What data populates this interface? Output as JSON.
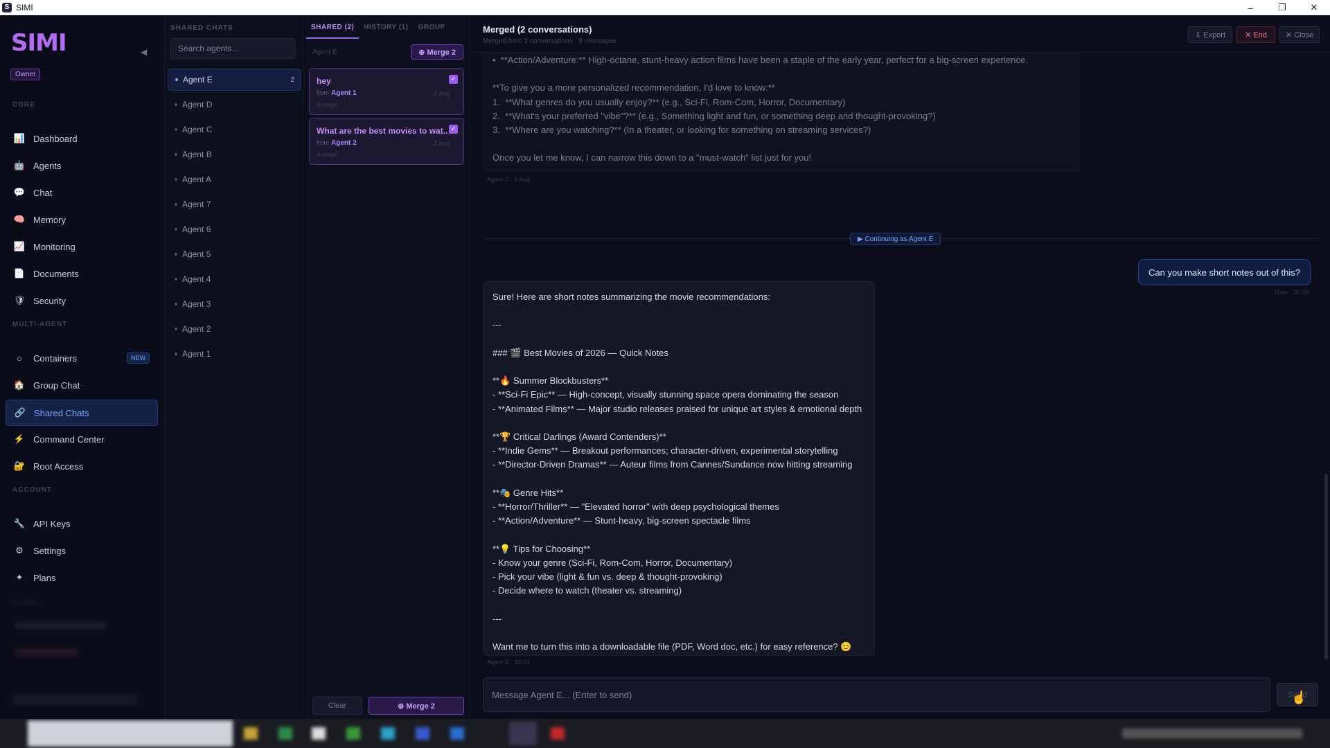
{
  "window": {
    "title": "SIMI",
    "minimize": "–",
    "maximize": "❐",
    "close": "✕"
  },
  "sidebar": {
    "logo": "SIMI",
    "collapse_icon": "◀",
    "role_badge": "Owner",
    "sections": {
      "core": "CORE",
      "multi_agent": "MULTI-AGENT",
      "account": "ACCOUNT",
      "admin": "ADMIN"
    },
    "core_items": [
      {
        "label": "Dashboard",
        "icon": "📊"
      },
      {
        "label": "Agents",
        "icon": "🤖"
      },
      {
        "label": "Chat",
        "icon": "💬"
      },
      {
        "label": "Memory",
        "icon": "🧠"
      },
      {
        "label": "Monitoring",
        "icon": "📈"
      },
      {
        "label": "Documents",
        "icon": "📄"
      },
      {
        "label": "Security",
        "icon": "🛡"
      }
    ],
    "multi_items": [
      {
        "label": "Containers",
        "icon": "○",
        "badge": "NEW"
      },
      {
        "label": "Group Chat",
        "icon": "🏠"
      },
      {
        "label": "Shared Chats",
        "icon": "🔗",
        "active": true
      },
      {
        "label": "Command Center",
        "icon": "⚡"
      },
      {
        "label": "Root Access",
        "icon": "🔐"
      }
    ],
    "account_items": [
      {
        "label": "API Keys",
        "icon": "🔧"
      },
      {
        "label": "Settings",
        "icon": "⚙"
      },
      {
        "label": "Plans",
        "icon": "✦"
      }
    ]
  },
  "agents_column": {
    "title": "SHARED CHATS",
    "search_placeholder": "Search agents...",
    "agents": [
      {
        "name": "Agent E",
        "count": "2",
        "active": true
      },
      {
        "name": "Agent D"
      },
      {
        "name": "Agent C"
      },
      {
        "name": "Agent B"
      },
      {
        "name": "Agent A"
      },
      {
        "name": "Agent 7"
      },
      {
        "name": "Agent 6"
      },
      {
        "name": "Agent 5"
      },
      {
        "name": "Agent 4"
      },
      {
        "name": "Agent 3"
      },
      {
        "name": "Agent 2"
      },
      {
        "name": "Agent 1"
      }
    ]
  },
  "shared_panel": {
    "tabs": [
      {
        "label": "SHARED (2)",
        "active": true
      },
      {
        "label": "HISTORY (1)"
      },
      {
        "label": "GROUP"
      }
    ],
    "subtitle": "Agent E",
    "merge_top": "⊕ Merge 2",
    "cards": [
      {
        "title": "hey",
        "from_label": "from",
        "from": "Agent 1",
        "date": "3 Aug",
        "msgs": "4 msgs",
        "check": "✓"
      },
      {
        "title": "What are the best movies to wat...",
        "from_label": "from",
        "from": "Agent 2",
        "date": "3 Aug",
        "msgs": "4 msgs",
        "check": "✓"
      }
    ],
    "clear": "Clear",
    "merge_bottom": "⊕ Merge 2"
  },
  "main": {
    "title": "Merged (2 conversations)",
    "subtitle": "Merged from 2 conversations · 8 messages",
    "export": "⇩ Export",
    "end": "✕ End",
    "close": "✕ Close",
    "ai_message_1": "•  **Action/Adventure:** High-octane, stunt-heavy action films have been a staple of the early year, perfect for a big-screen experience.\n\n**To give you a more personalized recommendation, I'd love to know:**\n1.  **What genres do you usually enjoy?** (e.g., Sci-Fi, Rom-Com, Horror, Documentary)\n2.  **What's your preferred \"vibe\"?** (e.g., Something light and fun, or something deep and thought-provoking?)\n3.  **Where are you watching?** (In a theater, or looking for something on streaming services?)\n\nOnce you let me know, I can narrow this down to a \"must-watch\" list just for you!",
    "ai_meta_1": "Agent 2 · 3 Aug",
    "continuing": "▶ Continuing as Agent E",
    "user_message": "Can you make short notes out of this?",
    "user_meta": "User · 20:00",
    "ai_message_2": "Sure! Here are short notes summarizing the movie recommendations:\n\n---\n\n### 🎬 Best Movies of 2026 — Quick Notes\n\n**🔥 Summer Blockbusters**\n- **Sci-Fi Epic** — High-concept, visually stunning space opera dominating the season\n- **Animated Films** — Major studio releases praised for unique art styles & emotional depth\n\n**🏆 Critical Darlings (Award Contenders)**\n- **Indie Gems** — Breakout performances; character-driven, experimental storytelling\n- **Director-Driven Dramas** — Auteur films from Cannes/Sundance now hitting streaming\n\n**🎭 Genre Hits**\n- **Horror/Thriller** — \"Elevated horror\" with deep psychological themes\n- **Action/Adventure** — Stunt-heavy, big-screen spectacle films\n\n**💡 Tips for Choosing**\n- Know your genre (Sci-Fi, Rom-Com, Horror, Documentary)\n- Pick your vibe (light & fun vs. deep & thought-provoking)\n- Decide where to watch (theater vs. streaming)\n\n---\n\nWant me to turn this into a downloadable file (PDF, Word doc, etc.) for easy reference? 😊",
    "ai_meta_2": "Agent E · 20:01",
    "input_placeholder": "Message Agent E... (Enter to send)",
    "send": "Send"
  },
  "colors": {
    "accent_purple": "#b46cf5",
    "accent_blue": "#7ba6ff",
    "danger": "#f07a8a",
    "bg": "#0b0e1a"
  }
}
